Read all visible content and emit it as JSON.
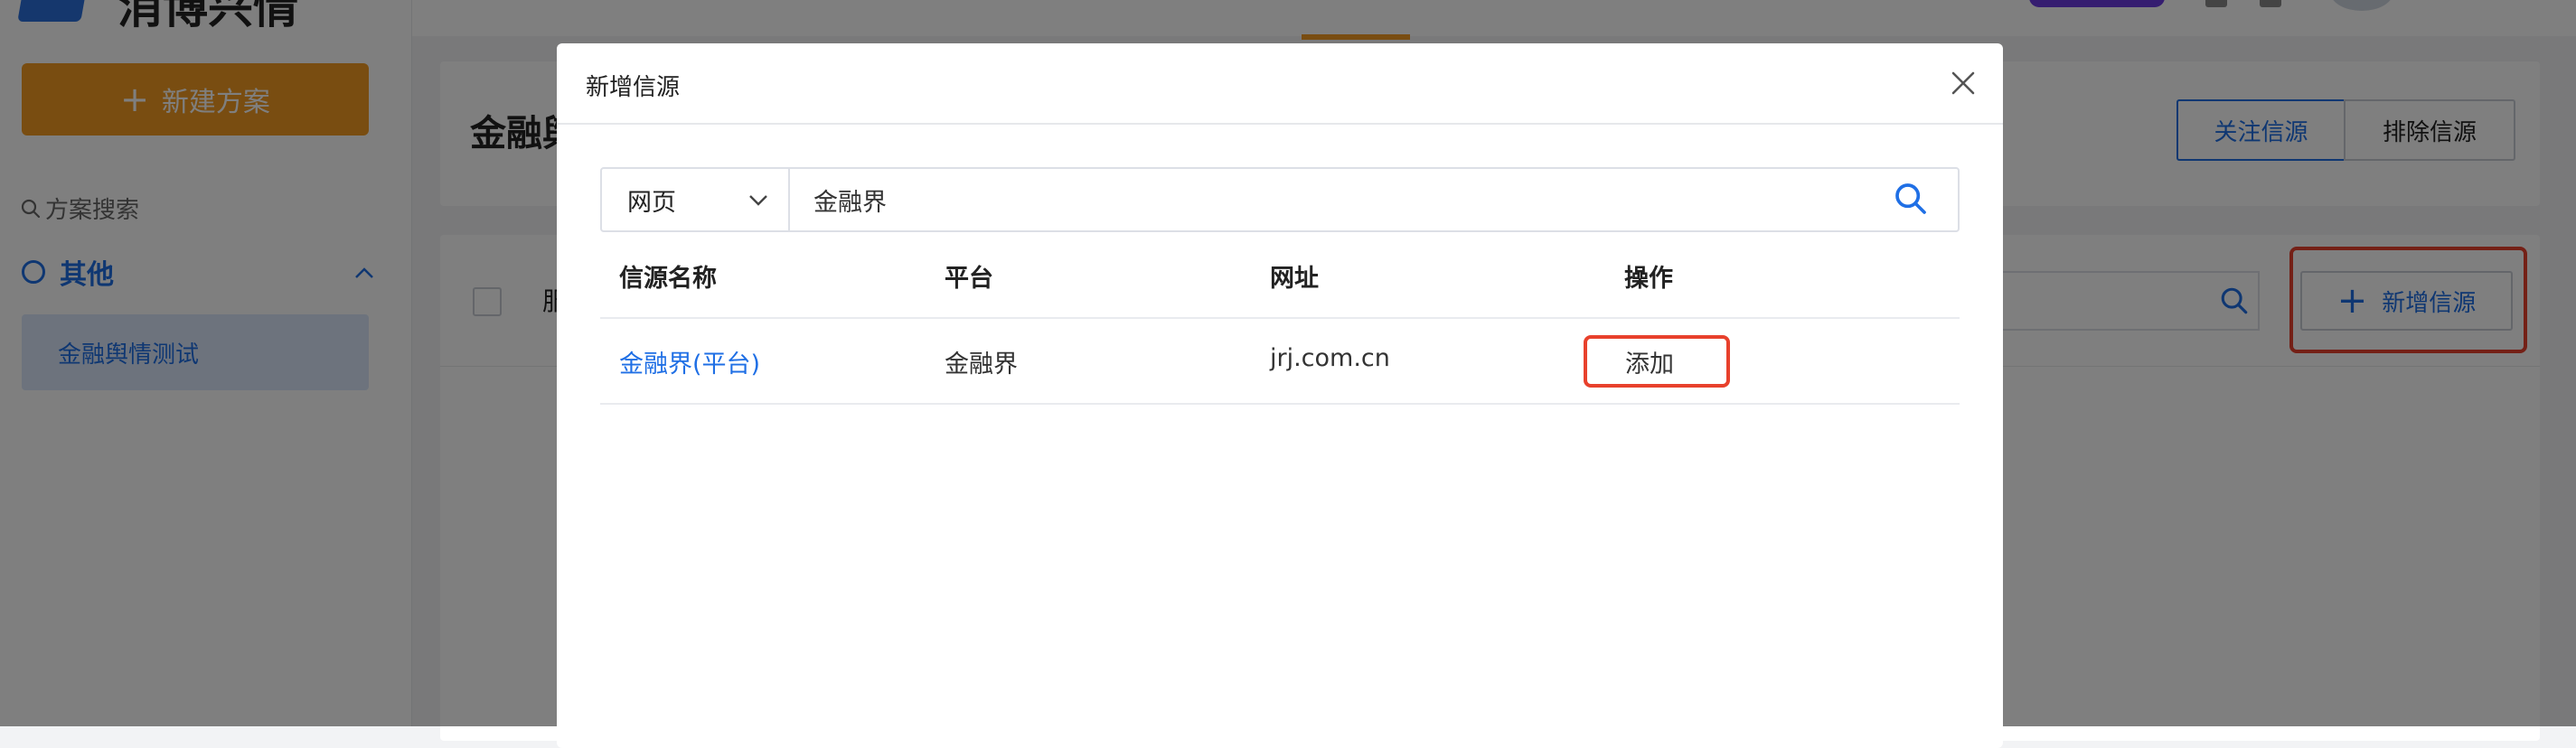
{
  "app": {
    "logo_text": "消博兴情",
    "new_plan_button": "新建方案",
    "plan_search_label": "方案搜索",
    "group_label": "其他",
    "plan_item": "金融舆情测试"
  },
  "main": {
    "page_title": "金融舆",
    "follow_sources_button": "关注信源",
    "exclude_sources_button": "排除信源",
    "list_header_partial": "服",
    "add_source_button": "新增信源"
  },
  "dialog": {
    "title": "新增信源",
    "type_select_value": "网页",
    "search_value": "金融界",
    "columns": [
      "信源名称",
      "平台",
      "网址",
      "操作"
    ],
    "rows": [
      {
        "name": "金融界(平台)",
        "platform": "金融界",
        "url": "jrj.com.cn",
        "action": "添加"
      }
    ]
  },
  "colors": {
    "accent_blue": "#1f6fe5",
    "orange": "#f39b22",
    "highlight_red": "#e8412c"
  },
  "icons": [
    "search-icon",
    "close-icon",
    "chevron-down-icon",
    "chevron-up-icon",
    "plus-icon",
    "checkbox-icon"
  ]
}
